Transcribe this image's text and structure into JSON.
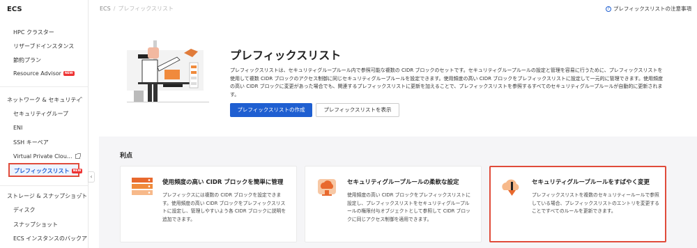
{
  "sidebar": {
    "title": "ECS",
    "items_top": [
      {
        "label": "HPC クラスター"
      },
      {
        "label": "リザーブドインスタンス"
      },
      {
        "label": "節約プラン"
      },
      {
        "label": "Resource Advisor",
        "badge": "NEW"
      }
    ],
    "network_group": "ネットワーク & セキュリティ",
    "network_items": [
      {
        "label": "セキュリティグループ"
      },
      {
        "label": "ENI"
      },
      {
        "label": "SSH キーペア"
      },
      {
        "label": "Virtual Private Clou..."
      }
    ],
    "active_item": {
      "label": "プレフィックスリスト",
      "badge": "NEW"
    },
    "storage_group": "ストレージ & スナップショット",
    "storage_items": [
      {
        "label": "ディスク"
      },
      {
        "label": "スナップショット"
      },
      {
        "label": "ECS インスタンスのバックアップ"
      }
    ]
  },
  "breadcrumb": {
    "root": "ECS",
    "separator": "/",
    "current": "プレフィックスリスト"
  },
  "help_link": "プレフィックスリストの注意事項",
  "hero": {
    "title": "プレフィックスリスト",
    "description": "プレフィックスリストは、セキュリティグループルール内で参照可能な複数の CIDR ブロックのセットです。セキュリティグループルールの設定と管理を容易に行うために、プレフィックスリストを使用して複数 CIDR ブロックのアクセス制御に同じセキュリティグループルールを設定できます。使用頻度の高い CIDR ブロックをプレフィックスリストに設定して一元的に管理できます。使用頻度の高い CIDR ブロックに変更があった場合でも、関連するプレフィックスリストに更新を加えることで、プレフィックスリストを参照するすべてのセキュリティグループルールが自動的に更新されます。",
    "primary_button": "プレフィックスリストの作成",
    "secondary_button": "プレフィックスリストを表示"
  },
  "benefits": {
    "title": "利点",
    "cards": [
      {
        "icon": "server-stack-icon",
        "title": "使用頻度の高い CIDR ブロックを簡単に管理",
        "description": "プレフィックスには複数の CIDR ブロックを設定できます。使用頻度の高い CIDR ブロックをプレフィックスリストに設定し、管理しやすいよう各 CIDR ブロックに説明を追加できます。"
      },
      {
        "icon": "cloud-shield-icon",
        "title": "セキュリティグループルールの柔軟な設定",
        "description": "使用頻度の高い CIDR ブロックをプレフィックスリストに設定し、プレフィックスリストをセキュリティグループルールの権限付与オブジェクトとして参照して CIDR ブロックに同じアクセス制御を適用できます。"
      },
      {
        "icon": "cloud-update-icon",
        "title": "セキュリティグループルールをすばやく変更",
        "description": "プレフィックスリストを複数のセキュリティールールで参照している場合、プレフィックスリストのエントリを変更することですべてのルールを更新できます。"
      }
    ]
  },
  "colors": {
    "accent": "#1f5fd1",
    "highlight": "#e04b3a",
    "icon_orange": "#f08a3c"
  }
}
